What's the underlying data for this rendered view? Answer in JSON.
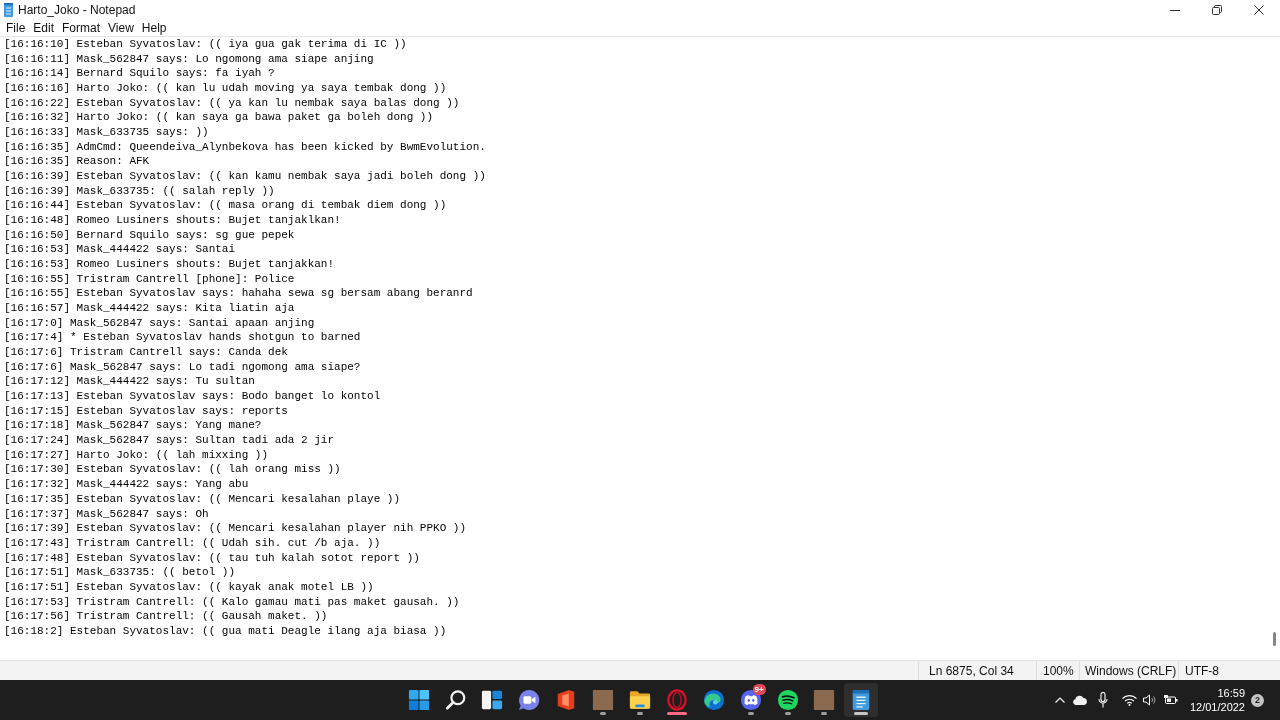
{
  "window": {
    "title": "Harto_Joko - Notepad"
  },
  "menu": [
    "File",
    "Edit",
    "Format",
    "View",
    "Help"
  ],
  "editor": {
    "lines": [
      "[16:16:10] Esteban Syvatoslav: (( iya gua gak terima di IC ))",
      "[16:16:11] Mask_562847 says: Lo ngomong ama siape anjing",
      "[16:16:14] Bernard Squilo says: fa iyah ?",
      "[16:16:16] Harto Joko: (( kan lu udah moving ya saya tembak dong ))",
      "[16:16:22] Esteban Syvatoslav: (( ya kan lu nembak saya balas dong ))",
      "[16:16:32] Harto Joko: (( kan saya ga bawa paket ga boleh dong ))",
      "[16:16:33] Mask_633735 says: ))",
      "[16:16:35] AdmCmd: Queendeiva_Alynbekova has been kicked by BwmEvolution.",
      "[16:16:35] Reason: AFK",
      "[16:16:39] Esteban Syvatoslav: (( kan kamu nembak saya jadi boleh dong ))",
      "[16:16:39] Mask_633735: (( salah reply ))",
      "[16:16:44] Esteban Syvatoslav: (( masa orang di tembak diem dong ))",
      "[16:16:48] Romeo Lusiners shouts: Bujet tanjaklkan!",
      "[16:16:50] Bernard Squilo says: sg gue pepek",
      "[16:16:53] Mask_444422 says: Santai",
      "[16:16:53] Romeo Lusiners shouts: Bujet tanjakkan!",
      "[16:16:55] Tristram Cantrell [phone]: Police",
      "[16:16:55] Esteban Syvatoslav says: hahaha sewa sg bersam abang beranrd",
      "[16:16:57] Mask_444422 says: Kita liatin aja",
      "[16:17:0] Mask_562847 says: Santai apaan anjing",
      "[16:17:4] * Esteban Syvatoslav hands shotgun to barned",
      "[16:17:6] Tristram Cantrell says: Canda dek",
      "[16:17:6] Mask_562847 says: Lo tadi ngomong ama siape?",
      "[16:17:12] Mask_444422 says: Tu sultan",
      "[16:17:13] Esteban Syvatoslav says: Bodo banget lo kontol",
      "[16:17:15] Esteban Syvatoslav says: reports",
      "[16:17:18] Mask_562847 says: Yang mane?",
      "[16:17:24] Mask_562847 says: Sultan tadi ada 2 jir",
      "[16:17:27] Harto Joko: (( lah mixxing ))",
      "[16:17:30] Esteban Syvatoslav: (( lah orang miss ))",
      "[16:17:32] Mask_444422 says: Yang abu",
      "[16:17:35] Esteban Syvatoslav: (( Mencari kesalahan playe ))",
      "[16:17:37] Mask_562847 says: Oh",
      "[16:17:39] Esteban Syvatoslav: (( Mencari kesalahan player nih PPKO ))",
      "[16:17:43] Tristram Cantrell: (( Udah sih. cut /b aja. ))",
      "[16:17:48] Esteban Syvatoslav: (( tau tuh kalah sotot report ))",
      "[16:17:51] Mask_633735: (( betol ))",
      "[16:17:51] Esteban Syvatoslav: (( kayak anak motel LB ))",
      "[16:17:53] Tristram Cantrell: (( Kalo gamau mati pas maket gausah. ))",
      "[16:17:56] Tristram Cantrell: (( Gausah maket. ))",
      "[16:18:2] Esteban Syvatoslav: (( gua mati Deagle ilang aja biasa ))"
    ]
  },
  "status_bar": {
    "position": "Ln 6875, Col 34",
    "zoom": "100%",
    "line_ending": "Windows (CRLF)",
    "encoding": "UTF-8"
  },
  "taskbar": {
    "apps": [
      {
        "kind": "start",
        "running": false,
        "attention": false,
        "selected": false
      },
      {
        "kind": "search",
        "running": false,
        "attention": false,
        "selected": false
      },
      {
        "kind": "widgets",
        "running": false,
        "attention": false,
        "selected": false
      },
      {
        "kind": "videochat",
        "running": false,
        "attention": false,
        "selected": false
      },
      {
        "kind": "door",
        "running": false,
        "attention": false,
        "selected": false
      },
      {
        "kind": "thumbnail",
        "running": true,
        "attention": false,
        "selected": false
      },
      {
        "kind": "folder",
        "running": true,
        "attention": false,
        "selected": false
      },
      {
        "kind": "ring",
        "running": true,
        "attention": true,
        "selected": false
      },
      {
        "kind": "swirl",
        "running": false,
        "attention": false,
        "selected": false
      },
      {
        "kind": "controller",
        "running": true,
        "attention": false,
        "selected": false,
        "badge": "9+"
      },
      {
        "kind": "waves",
        "running": true,
        "attention": false,
        "selected": false
      },
      {
        "kind": "thumbnail",
        "running": true,
        "attention": false,
        "selected": false
      },
      {
        "kind": "notepad",
        "running": true,
        "attention": false,
        "selected": true
      }
    ],
    "clock": {
      "time": "16:59",
      "date": "12/01/2022"
    },
    "notifications": "2"
  }
}
